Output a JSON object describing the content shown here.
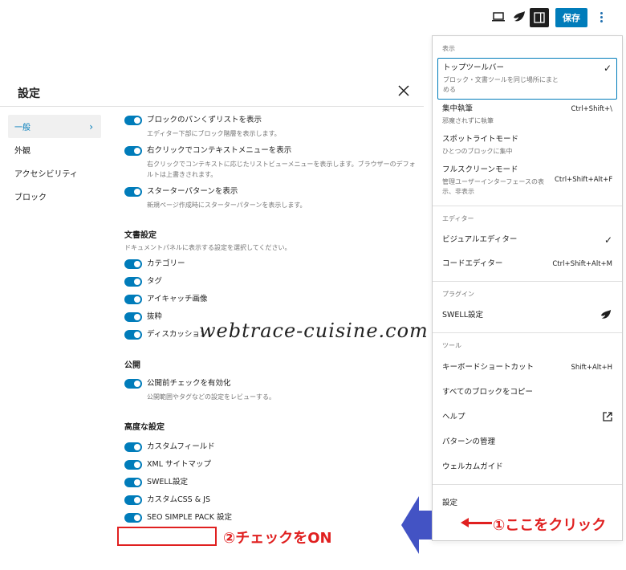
{
  "toolbar": {
    "save_label": "保存",
    "icons": [
      "laptop-icon",
      "swell-logo-icon",
      "sidebar-toggle-icon",
      "more-vertical-icon"
    ]
  },
  "modal": {
    "title": "設定",
    "nav": [
      {
        "label": "一般",
        "active": true
      },
      {
        "label": "外観"
      },
      {
        "label": "アクセシビリティ"
      },
      {
        "label": "ブロック"
      }
    ],
    "general_options": [
      {
        "label": "ブロックのパンくずリストを表示",
        "help": "エディター下部にブロック階層を表示します。",
        "on": true
      },
      {
        "label": "右クリックでコンテキストメニューを表示",
        "help": "右クリックでコンテキストに応じたリストビューメニューを表示します。ブラウザーのデフォルトは上書きされます。",
        "on": true
      },
      {
        "label": "スターターパターンを表示",
        "help": "新規ページ作成時にスターターパターンを表示します。",
        "on": true
      }
    ],
    "document": {
      "title": "文書設定",
      "desc": "ドキュメントパネルに表示する設定を選択してください。",
      "options": [
        "カテゴリー",
        "タグ",
        "アイキャッチ画像",
        "抜粋",
        "ディスカッション"
      ]
    },
    "publish": {
      "title": "公開",
      "option": {
        "label": "公開前チェックを有効化",
        "help": "公開範囲やタグなどの設定をレビューする。",
        "on": true
      }
    },
    "advanced": {
      "title": "高度な設定",
      "options": [
        "カスタムフィールド",
        "XML サイトマップ",
        "SWELL設定",
        "カスタムCSS & JS",
        "SEO SIMPLE PACK 設定"
      ]
    }
  },
  "menu": {
    "view": {
      "label": "表示",
      "items": [
        {
          "label": "トップツールバー",
          "help": "ブロック・文書ツールを同じ場所にまとめる",
          "checked": true
        },
        {
          "label": "集中執筆",
          "help": "邪魔されずに執筆",
          "shortcut": "Ctrl+Shift+\\"
        },
        {
          "label": "スポットライトモード",
          "help": "ひとつのブロックに集中"
        },
        {
          "label": "フルスクリーンモード",
          "help": "管理ユーザーインターフェースの表示、非表示",
          "shortcut": "Ctrl+Shift+Alt+F"
        }
      ]
    },
    "editor": {
      "label": "エディター",
      "items": [
        {
          "label": "ビジュアルエディター",
          "checked": true
        },
        {
          "label": "コードエディター",
          "shortcut": "Ctrl+Shift+Alt+M"
        }
      ]
    },
    "plugins": {
      "label": "プラグイン",
      "items": [
        {
          "label": "SWELL設定"
        }
      ]
    },
    "tools": {
      "label": "ツール",
      "items": [
        {
          "label": "キーボードショートカット",
          "shortcut": "Shift+Alt+H"
        },
        {
          "label": "すべてのブロックをコピー"
        },
        {
          "label": "ヘルプ"
        },
        {
          "label": "パターンの管理"
        },
        {
          "label": "ウェルカムガイド"
        }
      ]
    },
    "settings_item": "設定"
  },
  "annotations": {
    "click_here": "①ここをクリック",
    "check_on": "②チェックをON",
    "watermark": "webtrace-cuisine.com",
    "accent": "#e02020",
    "arrow_color": "#4353c4"
  },
  "colors": {
    "primary": "#007cba",
    "text": "#1e1e1e",
    "muted": "#757575"
  }
}
